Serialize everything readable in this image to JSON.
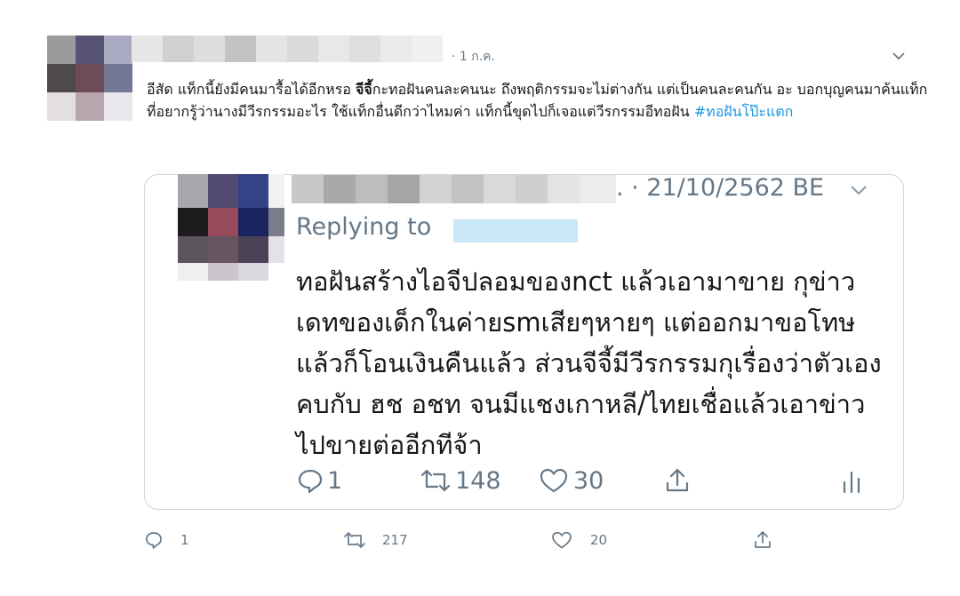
{
  "tweet": {
    "time": "· 1 ก.ค.",
    "text_part1": "อีสัด แท็กนี้ยังมีคนมารื้อได้อีกหรอ ",
    "text_bold": "จีจี้",
    "text_part2": "กะทอฝันคนละคนนะ ถึงพฤติกรรมจะไม่ต่างกัน แต่เป็นคนละคนกัน อะ บอกบุญคนมาค้นแท็กที่อยากรู้ว่านางมีวีรกรรมอะไร ใช้แท็กอื่นดีกว่าไหมค่า แท็กนี้ขุดไปก็เจอแต่วีรกรรมอีทอฝัน ",
    "hashtag": "#ทอฝันโป๊ะแตก",
    "reply_count": "1",
    "retweet_count": "217",
    "like_count": "20"
  },
  "quoted": {
    "time": ". · 21/10/2562 BE",
    "replying_to": "Replying to",
    "text": "ทอฝันสร้างไอจีปลอมของnct แล้วเอามาขาย กุข่าวเดทของเด็กในค่ายsmเสียๆหายๆ แต่ออกมาขอโทษแล้วก็โอนเงินคืนแล้ว ส่วนจีจี้มีวีรกรรมกุเรื่องว่าตัวเองคบกับ ฮช อชท จนมีแชงเกาหลี/ไทยเชื่อแล้วเอาข่าวไปขายต่ออีกทีจ้า",
    "reply_count": "1",
    "retweet_count": "148",
    "like_count": "30"
  },
  "icons": {
    "reply": "reply-icon",
    "retweet": "retweet-icon",
    "like": "heart-icon",
    "share": "share-icon",
    "analytics": "analytics-icon",
    "more": "chevron-down-icon"
  },
  "colors": {
    "text": "#14171a",
    "secondary": "#657786",
    "link": "#1b95e0",
    "border": "#ccd6dd"
  }
}
